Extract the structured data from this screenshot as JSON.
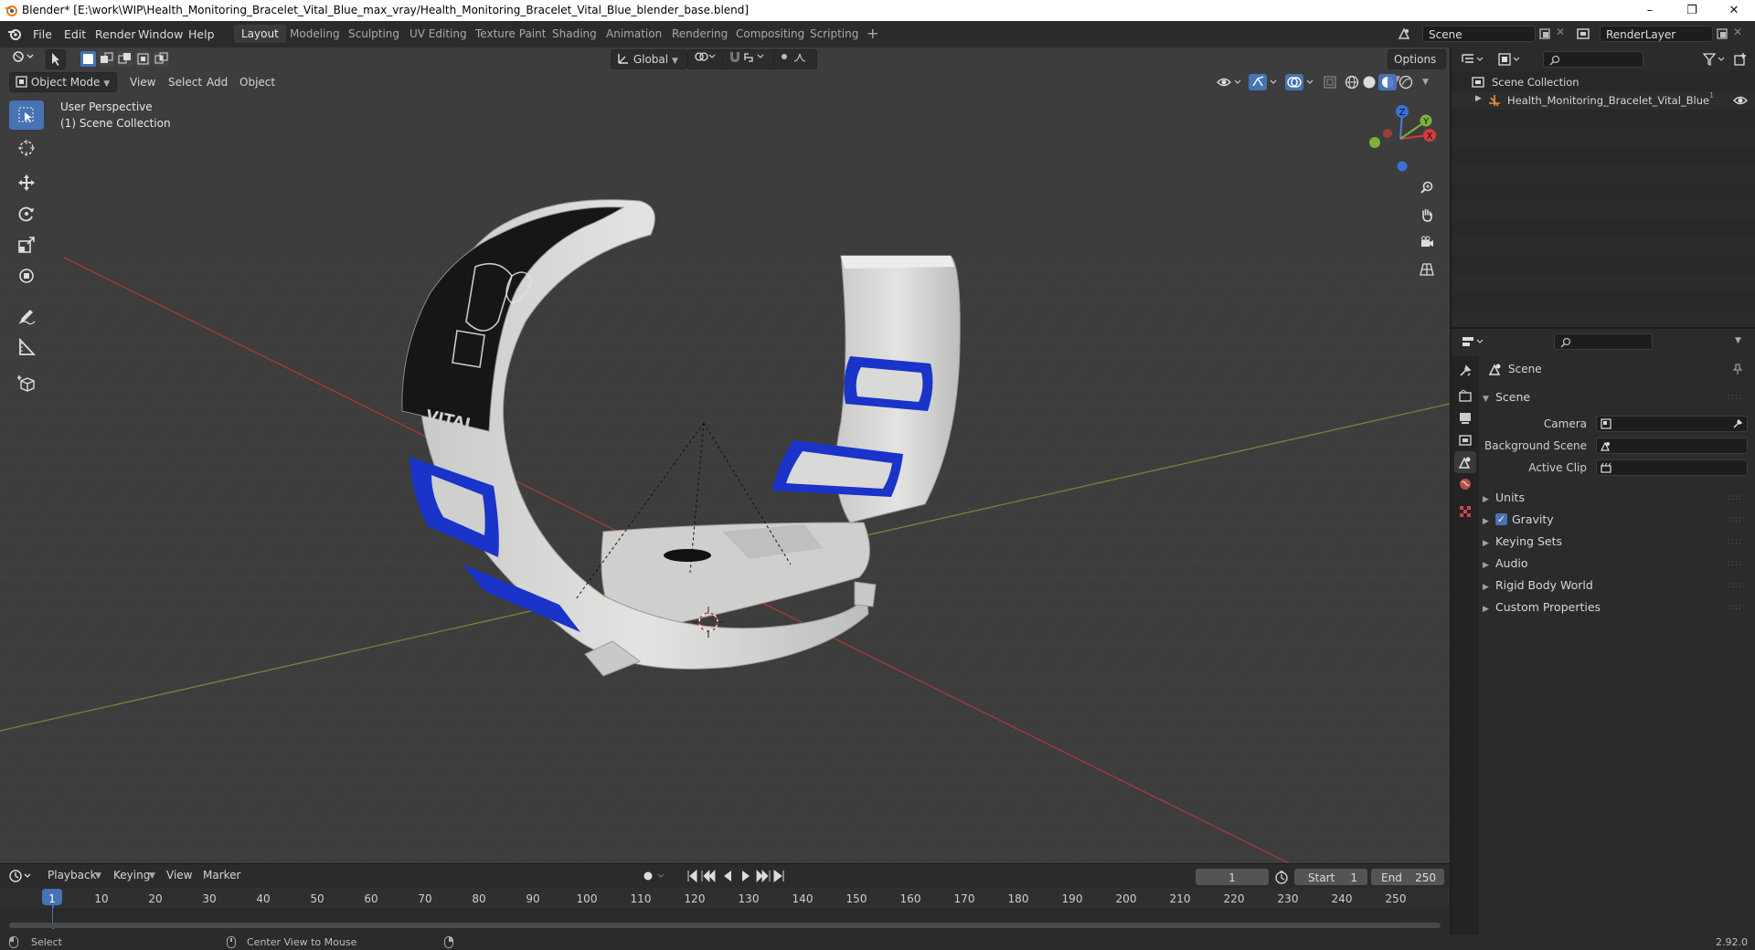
{
  "window": {
    "title": "Blender* [E:\\work\\WIP\\Health_Monitoring_Bracelet_Vital_Blue_max_vray/Health_Monitoring_Bracelet_Vital_Blue_blender_base.blend]",
    "minimize": "–",
    "maximize": "❐",
    "close": "✕"
  },
  "menubar": {
    "items": [
      "File",
      "Edit",
      "Render",
      "Window",
      "Help"
    ]
  },
  "workspaces": {
    "tabs": [
      "Layout",
      "Modeling",
      "Sculpting",
      "UV Editing",
      "Texture Paint",
      "Shading",
      "Animation",
      "Rendering",
      "Compositing",
      "Scripting"
    ],
    "active": "Layout",
    "add": "+"
  },
  "scene_selector": {
    "value": "Scene"
  },
  "renderlayer_selector": {
    "value": "RenderLayer"
  },
  "viewport": {
    "mode": "Object Mode",
    "menus": [
      "View",
      "Select",
      "Add",
      "Object"
    ],
    "transform_orientation": "Global",
    "options_label": "Options",
    "overlay_line1": "User Perspective",
    "overlay_line2": "(1) Scene Collection",
    "gizmo_axes": [
      "Z",
      "Y",
      "X"
    ],
    "product_label": "VITAL"
  },
  "outliner": {
    "root": "Scene Collection",
    "items": [
      {
        "name": "Health_Monitoring_Bracelet_Vital_Blue",
        "badge": "1"
      }
    ]
  },
  "properties": {
    "header": "Scene",
    "section": "Scene",
    "fields": [
      {
        "label": "Camera"
      },
      {
        "label": "Background Scene"
      },
      {
        "label": "Active Clip"
      }
    ],
    "panels": [
      "Units",
      "Gravity",
      "Keying Sets",
      "Audio",
      "Rigid Body World",
      "Custom Properties"
    ],
    "gravity_checked": true
  },
  "timeline": {
    "menus": [
      "Playback",
      "Keying",
      "View",
      "Marker"
    ],
    "current_frame": "1",
    "start_label": "Start",
    "start": "1",
    "end_label": "End",
    "end": "250",
    "ticks": [
      "1",
      "10",
      "20",
      "30",
      "40",
      "50",
      "60",
      "70",
      "80",
      "90",
      "100",
      "110",
      "120",
      "130",
      "140",
      "150",
      "160",
      "170",
      "180",
      "190",
      "200",
      "210",
      "220",
      "230",
      "240",
      "250"
    ]
  },
  "statusbar": {
    "left": "Select",
    "middle": "Center View to Mouse",
    "version": "2.92.0"
  },
  "colors": {
    "accent": "#4772b3",
    "viewport_bg": "#3d3d3d",
    "bracelet_body": "#d4d4d2",
    "bracelet_blue": "#1a33c8",
    "screen": "#151515",
    "x_axis": "#c23a3a",
    "y_axis": "#7aa33a"
  }
}
